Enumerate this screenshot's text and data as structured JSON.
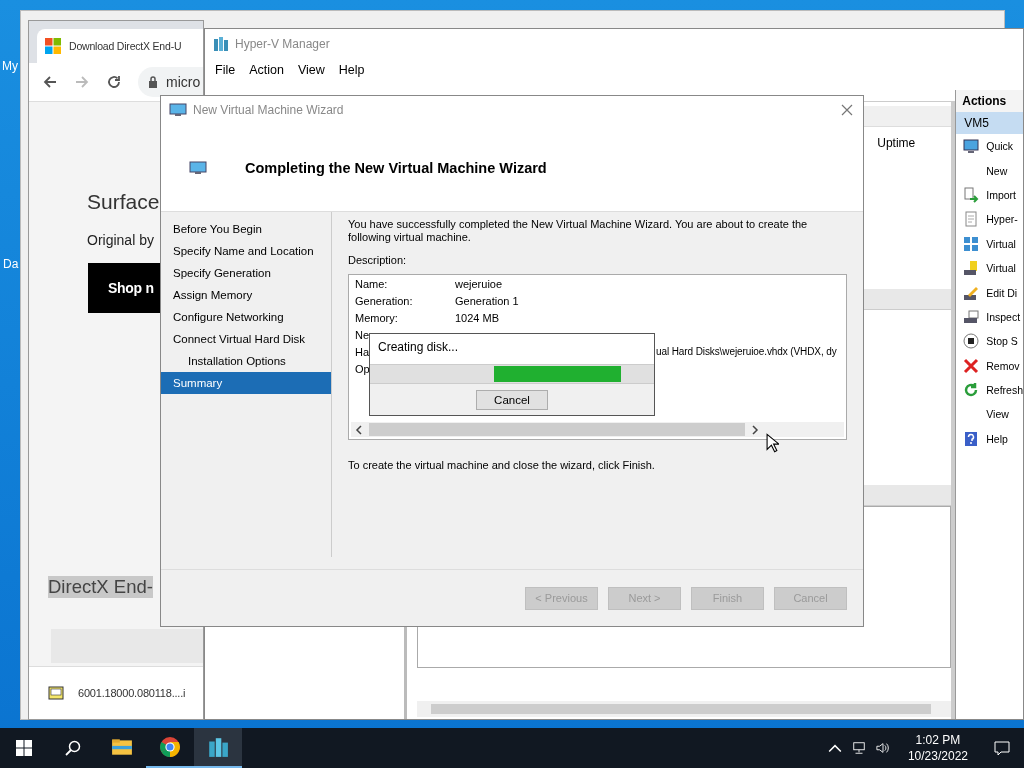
{
  "desktop": {
    "icons": [
      {
        "label": "My"
      },
      {
        "label": "Da"
      }
    ]
  },
  "browser": {
    "tab_title": "Download DirectX End-U",
    "address": "micro",
    "heading": "Surface",
    "subheading": "Original by",
    "shop_button": "Shop n",
    "selected_heading": "DirectX End-",
    "download": "6001.18000.080118....i"
  },
  "hyperv": {
    "title": "Hyper-V Manager",
    "menu": [
      "File",
      "Action",
      "View",
      "Help"
    ],
    "column": "Uptime",
    "actions": {
      "header": "Actions",
      "group": {
        "label": "VM5",
        "selected": true
      },
      "items": [
        {
          "label": "Quick",
          "kind": "monitor"
        },
        {
          "label": "New",
          "kind": "none"
        },
        {
          "label": "Import",
          "kind": "import"
        },
        {
          "label": "Hyper-",
          "kind": "document"
        },
        {
          "label": "Virtual",
          "kind": "grid"
        },
        {
          "label": "Virtual",
          "kind": "drive"
        },
        {
          "label": "Edit Di",
          "kind": "edit"
        },
        {
          "label": "Inspect",
          "kind": "inspect"
        },
        {
          "label": "Stop S",
          "kind": "stop"
        },
        {
          "label": "Remov",
          "kind": "remove"
        },
        {
          "label": "Refresh",
          "kind": "refresh"
        },
        {
          "label": "View",
          "kind": "none"
        },
        {
          "label": "Help",
          "kind": "help"
        }
      ]
    }
  },
  "wizard": {
    "title": "New Virtual Machine Wizard",
    "heading": "Completing the New Virtual Machine Wizard",
    "steps": [
      {
        "label": "Before You Begin",
        "selected": false
      },
      {
        "label": "Specify Name and Location",
        "selected": false
      },
      {
        "label": "Specify Generation",
        "selected": false
      },
      {
        "label": "Assign Memory",
        "selected": false
      },
      {
        "label": "Configure Networking",
        "selected": false
      },
      {
        "label": "Connect Virtual Hard Disk",
        "selected": false,
        "children": [
          {
            "label": "Installation Options",
            "selected": false
          }
        ]
      },
      {
        "label": "Summary",
        "selected": true
      }
    ],
    "intro": "You have successfully completed the New Virtual Machine Wizard. You are about to create the following virtual machine.",
    "description_label": "Description:",
    "details": [
      {
        "label": "Name:",
        "value": "wejeruioe"
      },
      {
        "label": "Generation:",
        "value": "Generation 1"
      },
      {
        "label": "Memory:",
        "value": "1024 MB"
      }
    ],
    "covered_details": [
      {
        "label": "Ne"
      },
      {
        "label": "Ha",
        "value": "ual Hard Disks\\wejeruioe.vhdx (VHDX, dy"
      },
      {
        "label": "Op"
      }
    ],
    "finish_hint": "To create the virtual machine and close the wizard, click Finish.",
    "buttons": [
      {
        "label": "< Previous",
        "disabled": true
      },
      {
        "label": "Next >",
        "disabled": true
      },
      {
        "label": "Finish",
        "disabled": true
      },
      {
        "label": "Cancel",
        "disabled": true
      }
    ]
  },
  "progress_dialog": {
    "message": "Creating disk...",
    "button": "Cancel"
  },
  "taskbar": {
    "apps": [
      {
        "kind": "explorer",
        "running": false,
        "selected": false
      },
      {
        "kind": "chrome",
        "running": true,
        "selected": false
      },
      {
        "kind": "hyperv",
        "running": true,
        "selected": true
      }
    ],
    "time": "1:02 PM",
    "date": "10/23/2022"
  }
}
